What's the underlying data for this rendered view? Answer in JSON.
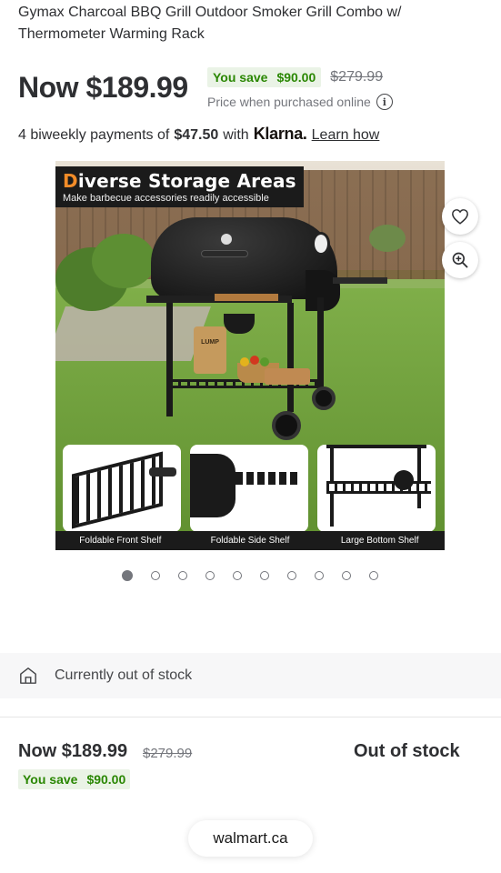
{
  "product": {
    "title": "Gymax Charcoal BBQ Grill Outdoor Smoker Grill Combo w/ Thermometer Warming Rack"
  },
  "pricing": {
    "now_label": "Now $189.99",
    "you_save_label": "You save",
    "you_save_amount": "$90.00",
    "was_price": "$279.99",
    "price_note": "Price when purchased online",
    "info_icon": "i"
  },
  "klarna": {
    "prefix": "4 biweekly payments of",
    "amount": "$47.50",
    "with": "with",
    "brand": "Klarna.",
    "link": "Learn how"
  },
  "image": {
    "banner_title_first": "D",
    "banner_title_rest": "iverse Storage Areas",
    "banner_subtitle": "Make barbecue accessories readily accessible",
    "bag_text": "LUMP",
    "captions": [
      "Foldable Front Shelf",
      "Foldable Side Shelf",
      "Large Bottom Shelf"
    ],
    "fav_icon": "heart-icon",
    "zoom_icon": "zoom-in-icon"
  },
  "carousel": {
    "total": 10,
    "active_index": 0
  },
  "stock": {
    "icon": "store-icon",
    "text": "Currently out of stock"
  },
  "footer": {
    "now_label": "Now $189.99",
    "was_price": "$279.99",
    "status": "Out of stock",
    "you_save_label": "You save",
    "you_save_amount": "$90.00"
  },
  "browser": {
    "url": "walmart.ca"
  },
  "colors": {
    "save_green": "#2a8703",
    "save_bg": "#eaf3e6",
    "text_primary": "#2e2f32",
    "text_secondary": "#74767c",
    "banner_accent": "#f28c28"
  }
}
